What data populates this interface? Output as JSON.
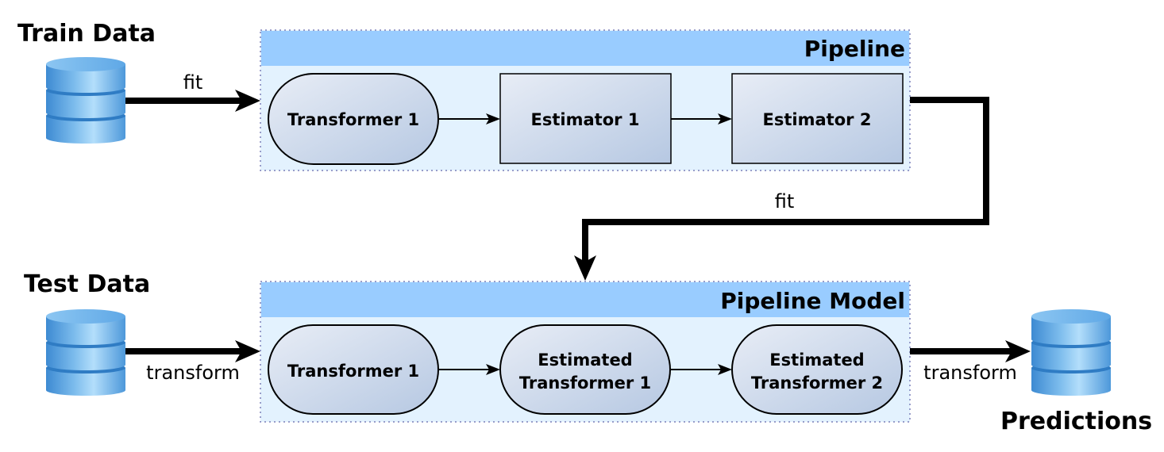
{
  "sources": {
    "train": {
      "label": "Train Data",
      "icon": "database-icon"
    },
    "test": {
      "label": "Test Data",
      "icon": "database-icon"
    },
    "output": {
      "label": "Predictions",
      "icon": "database-icon"
    }
  },
  "pipeline": {
    "title": "Pipeline",
    "stages": [
      {
        "label": "Transformer 1",
        "shape": "stadium"
      },
      {
        "label": "Estimator 1",
        "shape": "rectangle"
      },
      {
        "label": "Estimator 2",
        "shape": "rectangle"
      }
    ]
  },
  "pipeline_model": {
    "title": "Pipeline Model",
    "stages": [
      {
        "line1": "Transformer 1",
        "line2": "",
        "shape": "stadium"
      },
      {
        "line1": "Estimated",
        "line2": "Transformer 1",
        "shape": "stadium"
      },
      {
        "line1": "Estimated",
        "line2": "Transformer 2",
        "shape": "stadium"
      }
    ]
  },
  "edges": {
    "train_fit": "fit",
    "pipeline_fit": "fit",
    "test_transform": "transform",
    "output_transform": "transform"
  },
  "colors": {
    "header": "#99ccff",
    "body": "#e3f2fe",
    "node_start": "#e6ebf5",
    "node_end": "#b8cae4",
    "db_dark": "#3f8fd6",
    "db_light": "#a9d8f8"
  }
}
